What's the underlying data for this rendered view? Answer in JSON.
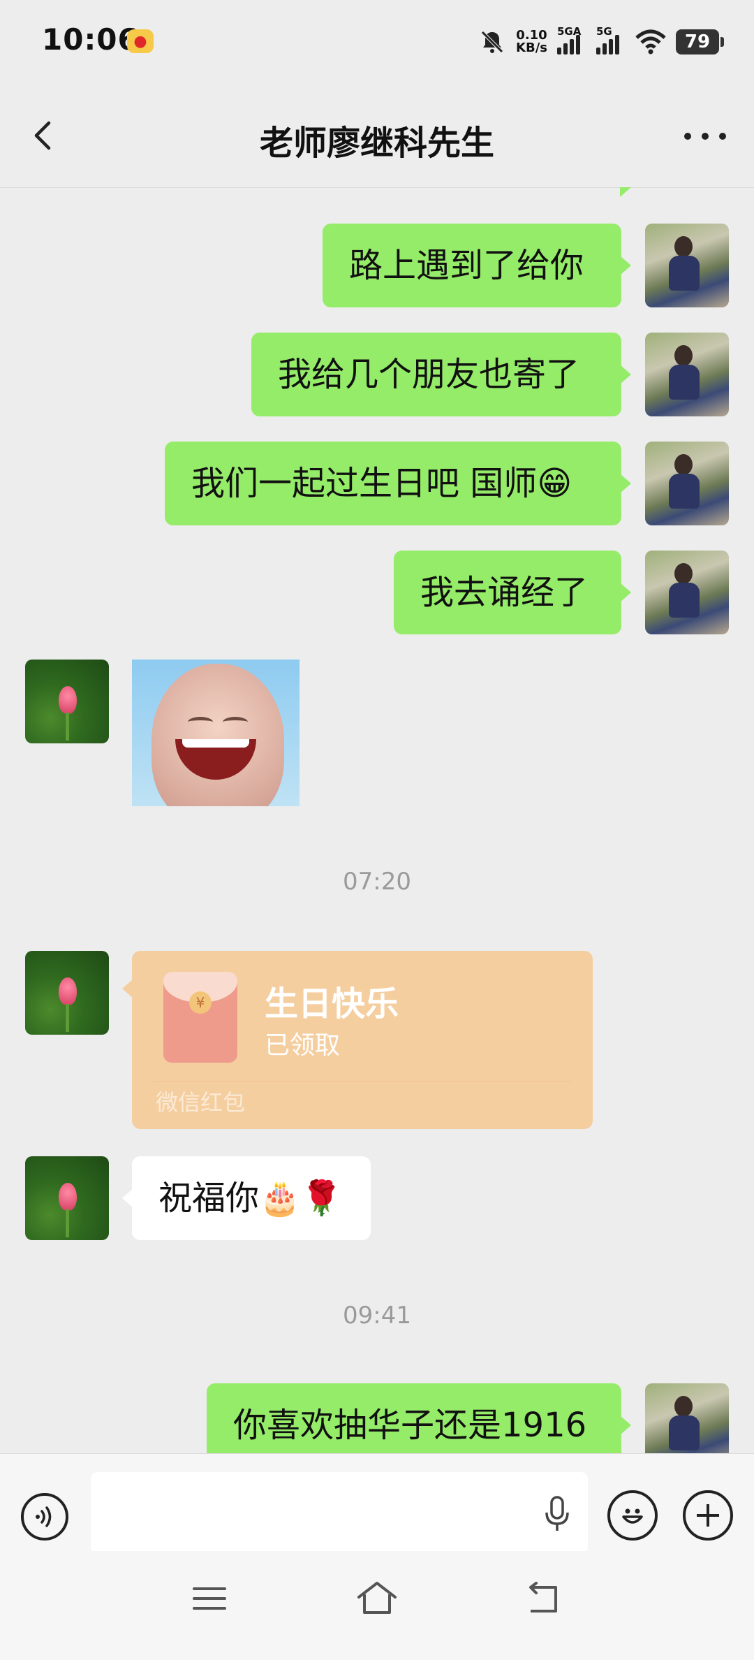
{
  "status_bar": {
    "time": "10:06",
    "net_speed_value": "0.10",
    "net_speed_unit": "KB/s",
    "signal1_label": "5GA",
    "signal2_label": "5G",
    "battery": "79"
  },
  "header": {
    "title": "老师廖继科先生"
  },
  "messages": {
    "m1": "路上遇到了给你",
    "m2": "我给几个朋友也寄了",
    "m3": "我们一起过生日吧 国师😁",
    "m4": "我去诵经了",
    "ts1": "07:20",
    "m5": "祝福你🎂🌹",
    "ts2": "09:41",
    "m6": "你喜欢抽华子还是1916"
  },
  "red_packet": {
    "title": "生日快乐",
    "status": "已领取",
    "footer": "微信红包",
    "coin": "¥"
  },
  "colors": {
    "my_bubble": "#95ec69",
    "their_bubble": "#ffffff",
    "red_packet": "#f5ce9f",
    "background": "#ededed"
  }
}
